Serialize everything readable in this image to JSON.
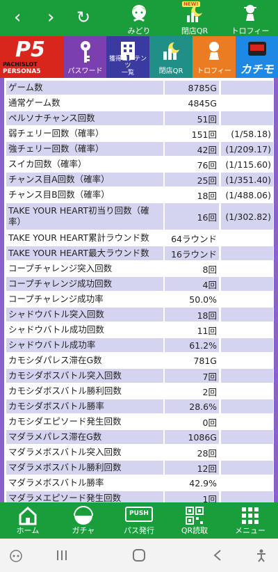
{
  "header": {
    "back": "‹",
    "forward": "›",
    "reload": "↻",
    "midori": "みどり",
    "closing_qr": "閉店QR",
    "closing_qr_badge": "NEW!",
    "trophy": "トロフィー"
  },
  "categories": {
    "logo_main": "P5",
    "logo_sub1": "PACHISLOT",
    "logo_sub2": "PERSONA5",
    "password": "パスワード",
    "content_line1": "獲得コンテンツ",
    "content_line2": "一覧",
    "closing_qr": "閉店QR",
    "trophy": "トロフィー",
    "extra": "カチモ"
  },
  "stats": [
    {
      "label": "ゲーム数",
      "value": "8785G",
      "ratio": ""
    },
    {
      "label": "通常ゲーム数",
      "value": "4845G",
      "ratio": ""
    },
    {
      "label": "ペルソナチャンス回数",
      "value": "51回",
      "ratio": ""
    },
    {
      "label": "弱チェリー回数（確率）",
      "value": "151回",
      "ratio": "(1/58.18)"
    },
    {
      "label": "強チェリー回数（確率）",
      "value": "42回",
      "ratio": "(1/209.17)"
    },
    {
      "label": "スイカ回数（確率）",
      "value": "76回",
      "ratio": "(1/115.60)"
    },
    {
      "label": "チャンス目A回数（確率）",
      "value": "25回",
      "ratio": "(1/351.40)"
    },
    {
      "label": "チャンス目B回数（確率）",
      "value": "18回",
      "ratio": "(1/488.06)"
    },
    {
      "label": "TAKE YOUR HEART初当り回数（確率）",
      "value": "16回",
      "ratio": "(1/302.82)"
    },
    {
      "label": "TAKE YOUR HEART累計ラウンド数",
      "value": "64ラウンド",
      "ratio": ""
    },
    {
      "label": "TAKE YOUR HEART最大ラウンド数",
      "value": "16ラウンド",
      "ratio": ""
    },
    {
      "label": "コープチャレンジ突入回数",
      "value": "8回",
      "ratio": ""
    },
    {
      "label": "コープチャレンジ成功回数",
      "value": "4回",
      "ratio": ""
    },
    {
      "label": "コープチャレンジ成功率",
      "value": "50.0%",
      "ratio": ""
    },
    {
      "label": "シャドウバトル突入回数",
      "value": "18回",
      "ratio": ""
    },
    {
      "label": "シャドウバトル成功回数",
      "value": "11回",
      "ratio": ""
    },
    {
      "label": "シャドウバトル成功率",
      "value": "61.2%",
      "ratio": ""
    },
    {
      "label": "カモシダパレス滞在G数",
      "value": "781G",
      "ratio": ""
    },
    {
      "label": "カモシダボスバトル突入回数",
      "value": "7回",
      "ratio": ""
    },
    {
      "label": "カモシダボスバトル勝利回数",
      "value": "2回",
      "ratio": ""
    },
    {
      "label": "カモシダボスバトル勝率",
      "value": "28.6%",
      "ratio": ""
    },
    {
      "label": "カモシダエピソード発生回数",
      "value": "0回",
      "ratio": ""
    },
    {
      "label": "マダラメパレス滞在G数",
      "value": "1086G",
      "ratio": ""
    },
    {
      "label": "マダラメボスバトル突入回数",
      "value": "28回",
      "ratio": ""
    },
    {
      "label": "マダラメボスバトル勝利回数",
      "value": "12回",
      "ratio": ""
    },
    {
      "label": "マダラメボスバトル勝率",
      "value": "42.9%",
      "ratio": ""
    },
    {
      "label": "マダラメエピソード発生回数",
      "value": "1回",
      "ratio": ""
    }
  ],
  "bottom_nav": {
    "home": "ホーム",
    "gacha": "ガチャ",
    "pass_issue": "パス発行",
    "pass_icon_text": "PUSH",
    "qr_read": "QR読取",
    "menu": "メニュー"
  },
  "colors": {
    "green": "#1a9e3b",
    "purple_frame": "#8a62c8",
    "row_stripe": "#d4d4f0"
  }
}
